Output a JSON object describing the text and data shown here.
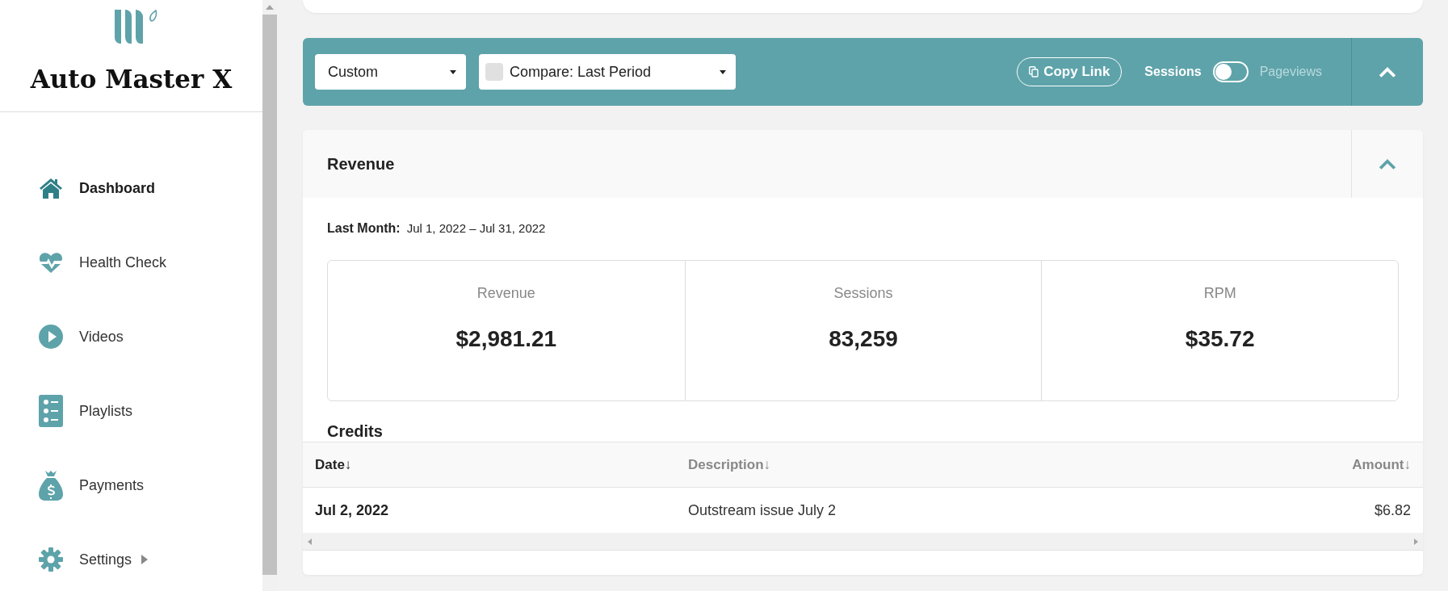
{
  "brand": {
    "name": "Auto Master X"
  },
  "sidebar": {
    "items": [
      {
        "label": "Dashboard",
        "selected": true,
        "has_submenu": false
      },
      {
        "label": "Health Check",
        "selected": false,
        "has_submenu": false
      },
      {
        "label": "Videos",
        "selected": false,
        "has_submenu": false
      },
      {
        "label": "Playlists",
        "selected": false,
        "has_submenu": false
      },
      {
        "label": "Payments",
        "selected": false,
        "has_submenu": false
      },
      {
        "label": "Settings",
        "selected": false,
        "has_submenu": true
      }
    ]
  },
  "toolbar": {
    "period_dropdown": {
      "value": "Custom"
    },
    "compare_dropdown": {
      "value": "Compare: Last Period",
      "checked": false
    },
    "copy_link": {
      "label": "Copy Link"
    },
    "metric_toggle": [
      {
        "label": "Sessions",
        "selected": true
      },
      {
        "label": "Pageviews",
        "selected": false
      }
    ],
    "expanded": true
  },
  "revenue_panel": {
    "title": "Revenue",
    "expanded": true,
    "period_label": "Last Month:",
    "period_range": "Jul 1, 2022 – Jul 31, 2022",
    "metrics": [
      {
        "label": "Revenue",
        "value": "$2,981.21"
      },
      {
        "label": "Sessions",
        "value": "83,259"
      },
      {
        "label": "RPM",
        "value": "$35.72"
      }
    ],
    "credits": {
      "title": "Credits",
      "columns": [
        {
          "label": "Date",
          "sort": "↓",
          "selected": true
        },
        {
          "label": "Description",
          "sort": "↓",
          "selected": false
        },
        {
          "label": "Amount",
          "sort": "↓",
          "selected": false
        }
      ],
      "rows": [
        [
          "Jul 2, 2022",
          "Outstream issue July 2",
          "$6.82"
        ]
      ]
    }
  }
}
